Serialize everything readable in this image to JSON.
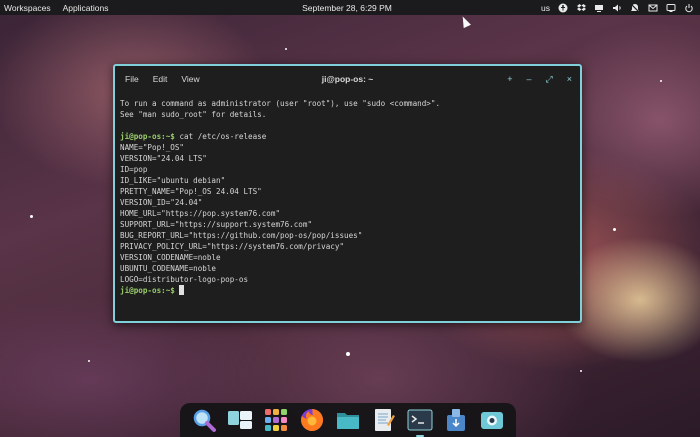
{
  "topbar": {
    "workspaces": "Workspaces",
    "applications": "Applications",
    "clock": "September 28, 6:29 PM",
    "layout": "us",
    "tray_icons": [
      "accessibility-icon",
      "dropbox-icon",
      "network-icon",
      "volume-icon",
      "notifications-off-icon",
      "mail-icon",
      "display-icon",
      "power-icon"
    ]
  },
  "terminal": {
    "title": "ji@pop-os: ~",
    "menu": [
      "File",
      "Edit",
      "View"
    ],
    "controls": [
      "new-tab-icon",
      "minimize-icon",
      "maximize-icon",
      "close-icon"
    ],
    "intro_lines": [
      "To run a command as administrator (user \"root\"), use \"sudo <command>\".",
      "See \"man sudo_root\" for details."
    ],
    "prompt": "ji@pop-os:~$",
    "command": " cat /etc/os-release",
    "output": [
      "NAME=\"Pop!_OS\"",
      "VERSION=\"24.04 LTS\"",
      "ID=pop",
      "ID_LIKE=\"ubuntu debian\"",
      "PRETTY_NAME=\"Pop!_OS 24.04 LTS\"",
      "VERSION_ID=\"24.04\"",
      "HOME_URL=\"https://pop.system76.com\"",
      "SUPPORT_URL=\"https://support.system76.com\"",
      "BUG_REPORT_URL=\"https://github.com/pop-os/pop/issues\"",
      "PRIVACY_POLICY_URL=\"https://system76.com/privacy\"",
      "VERSION_CODENAME=noble",
      "UBUNTU_CODENAME=noble",
      "LOGO=distributor-logo-pop-os"
    ],
    "final_prompt": "ji@pop-os:~$"
  },
  "dock": [
    {
      "name": "search-launcher-icon",
      "color": "#5aa0e8"
    },
    {
      "name": "workspaces-icon",
      "color": "#8fd3dc"
    },
    {
      "name": "app-grid-icon",
      "color": "#f0b040"
    },
    {
      "name": "firefox-icon",
      "color": "#ff7a1f"
    },
    {
      "name": "files-icon",
      "color": "#48b9c7"
    },
    {
      "name": "text-editor-icon",
      "color": "#7aa6c8"
    },
    {
      "name": "terminal-icon",
      "color": "#2b3a4a"
    },
    {
      "name": "pop-shop-icon",
      "color": "#4a86c8"
    },
    {
      "name": "screenshot-icon",
      "color": "#6fc8d6"
    }
  ]
}
